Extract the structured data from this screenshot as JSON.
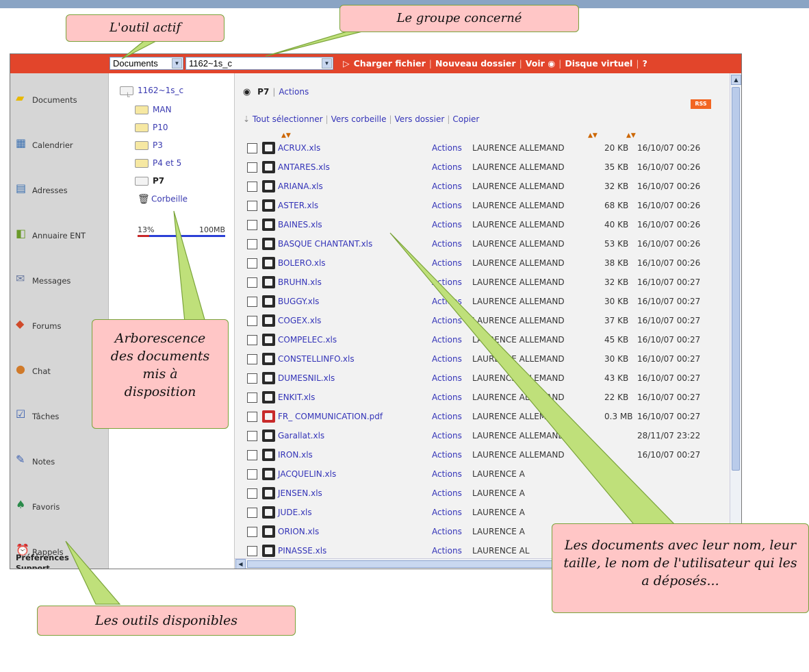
{
  "toolbar": {
    "tool_select": "Documents",
    "group_select": "1162~1s_c",
    "upload_label": "Charger fichier",
    "new_folder_label": "Nouveau dossier",
    "view_label": "Voir",
    "virtual_disk_label": "Disque virtuel",
    "help_label": "?"
  },
  "sidebar": {
    "items": [
      {
        "label": "Documents",
        "icon": "folder-icon"
      },
      {
        "label": "Calendrier",
        "icon": "calendar-icon"
      },
      {
        "label": "Adresses",
        "icon": "address-card-icon"
      },
      {
        "label": "Annuaire ENT",
        "icon": "directory-book-icon"
      },
      {
        "label": "Messages",
        "icon": "envelope-icon"
      },
      {
        "label": "Forums",
        "icon": "forum-icon"
      },
      {
        "label": "Chat",
        "icon": "chat-user-icon"
      },
      {
        "label": "Tâches",
        "icon": "checklist-icon"
      },
      {
        "label": "Notes",
        "icon": "note-pencil-icon"
      },
      {
        "label": "Favoris",
        "icon": "favorites-icon"
      },
      {
        "label": "Rappels",
        "icon": "alarm-clock-icon"
      }
    ],
    "preferences": "Préférences",
    "support": "Support"
  },
  "tree": {
    "root": "1162~1s_c",
    "folders": [
      "MAN",
      "P10",
      "P3",
      "P4 et 5",
      "P7"
    ],
    "trash": "Corbeille",
    "quota_percent_label": "13%",
    "quota_total_label": "100MB",
    "quota_fraction": 0.13
  },
  "main": {
    "current_folder": "P7",
    "actions_label": "Actions",
    "rss_label": "RSS",
    "select_all": "Tout sélectionner",
    "to_trash": "Vers corbeille",
    "to_folder": "Vers dossier",
    "copy": "Copier",
    "files": [
      {
        "name": "ACRUX.xls",
        "type": "xls",
        "actions": "Actions",
        "owner": "LAURENCE ALLEMAND",
        "size": "20 KB",
        "date": "16/10/07 00:26"
      },
      {
        "name": "ANTARES.xls",
        "type": "xls",
        "actions": "Actions",
        "owner": "LAURENCE ALLEMAND",
        "size": "35 KB",
        "date": "16/10/07 00:26"
      },
      {
        "name": "ARIANA.xls",
        "type": "xls",
        "actions": "Actions",
        "owner": "LAURENCE ALLEMAND",
        "size": "32 KB",
        "date": "16/10/07 00:26"
      },
      {
        "name": "ASTER.xls",
        "type": "xls",
        "actions": "Actions",
        "owner": "LAURENCE ALLEMAND",
        "size": "68 KB",
        "date": "16/10/07 00:26"
      },
      {
        "name": "BAINES.xls",
        "type": "xls",
        "actions": "Actions",
        "owner": "LAURENCE ALLEMAND",
        "size": "40 KB",
        "date": "16/10/07 00:26"
      },
      {
        "name": "BASQUE CHANTANT.xls",
        "type": "xls",
        "actions": "Actions",
        "owner": "LAURENCE ALLEMAND",
        "size": "53 KB",
        "date": "16/10/07 00:26"
      },
      {
        "name": "BOLERO.xls",
        "type": "xls",
        "actions": "Actions",
        "owner": "LAURENCE ALLEMAND",
        "size": "38 KB",
        "date": "16/10/07 00:26"
      },
      {
        "name": "BRUHN.xls",
        "type": "xls",
        "actions": "Actions",
        "owner": "LAURENCE ALLEMAND",
        "size": "32 KB",
        "date": "16/10/07 00:27"
      },
      {
        "name": "BUGGY.xls",
        "type": "xls",
        "actions": "Actions",
        "owner": "LAURENCE ALLEMAND",
        "size": "30 KB",
        "date": "16/10/07 00:27"
      },
      {
        "name": "COGEX.xls",
        "type": "xls",
        "actions": "Actions",
        "owner": "LAURENCE ALLEMAND",
        "size": "37 KB",
        "date": "16/10/07 00:27"
      },
      {
        "name": "COMPELEC.xls",
        "type": "xls",
        "actions": "Actions",
        "owner": "LAURENCE ALLEMAND",
        "size": "45 KB",
        "date": "16/10/07 00:27"
      },
      {
        "name": "CONSTELLINFO.xls",
        "type": "xls",
        "actions": "Actions",
        "owner": "LAURENCE ALLEMAND",
        "size": "30 KB",
        "date": "16/10/07 00:27"
      },
      {
        "name": "DUMESNIL.xls",
        "type": "xls",
        "actions": "Actions",
        "owner": "LAURENCE ALLEMAND",
        "size": "43 KB",
        "date": "16/10/07 00:27"
      },
      {
        "name": "ENKIT.xls",
        "type": "xls",
        "actions": "Actions",
        "owner": "LAURENCE ALLEMAND",
        "size": "22 KB",
        "date": "16/10/07 00:27"
      },
      {
        "name": "FR_ COMMUNICATION.pdf",
        "type": "pdf",
        "actions": "Actions",
        "owner": "LAURENCE ALLEMAND",
        "size": "0.3 MB",
        "date": "16/10/07 00:27"
      },
      {
        "name": "Garallat.xls",
        "type": "xls",
        "actions": "Actions",
        "owner": "LAURENCE ALLEMAND",
        "size": "",
        "date": "28/11/07 23:22"
      },
      {
        "name": "IRON.xls",
        "type": "xls",
        "actions": "Actions",
        "owner": "LAURENCE ALLEMAND",
        "size": "",
        "date": "16/10/07 00:27"
      },
      {
        "name": "JACQUELIN.xls",
        "type": "xls",
        "actions": "Actions",
        "owner": "LAURENCE A",
        "size": "",
        "date": ""
      },
      {
        "name": "JENSEN.xls",
        "type": "xls",
        "actions": "Actions",
        "owner": "LAURENCE A",
        "size": "",
        "date": ""
      },
      {
        "name": "JUDE.xls",
        "type": "xls",
        "actions": "Actions",
        "owner": "LAURENCE A",
        "size": "",
        "date": ""
      },
      {
        "name": "ORION.xls",
        "type": "xls",
        "actions": "Actions",
        "owner": "LAURENCE A",
        "size": "",
        "date": ""
      },
      {
        "name": "PINASSE.xls",
        "type": "xls",
        "actions": "Actions",
        "owner": "LAURENCE AL",
        "size": "",
        "date": ""
      }
    ]
  },
  "callouts": {
    "active_tool": "L'outil actif",
    "group": "Le groupe concerné",
    "tree": "Arborescence des documents mis à disposition",
    "documents": "Les documents avec leur nom, leur taille, le nom de l'utilisateur qui les a déposés...",
    "tools": "Les outils disponibles"
  },
  "colors": {
    "toolbar_red": "#e2452b",
    "link_blue": "#3434b8",
    "callout_pink": "#ffc6c6",
    "callout_border": "#7aa33a"
  }
}
